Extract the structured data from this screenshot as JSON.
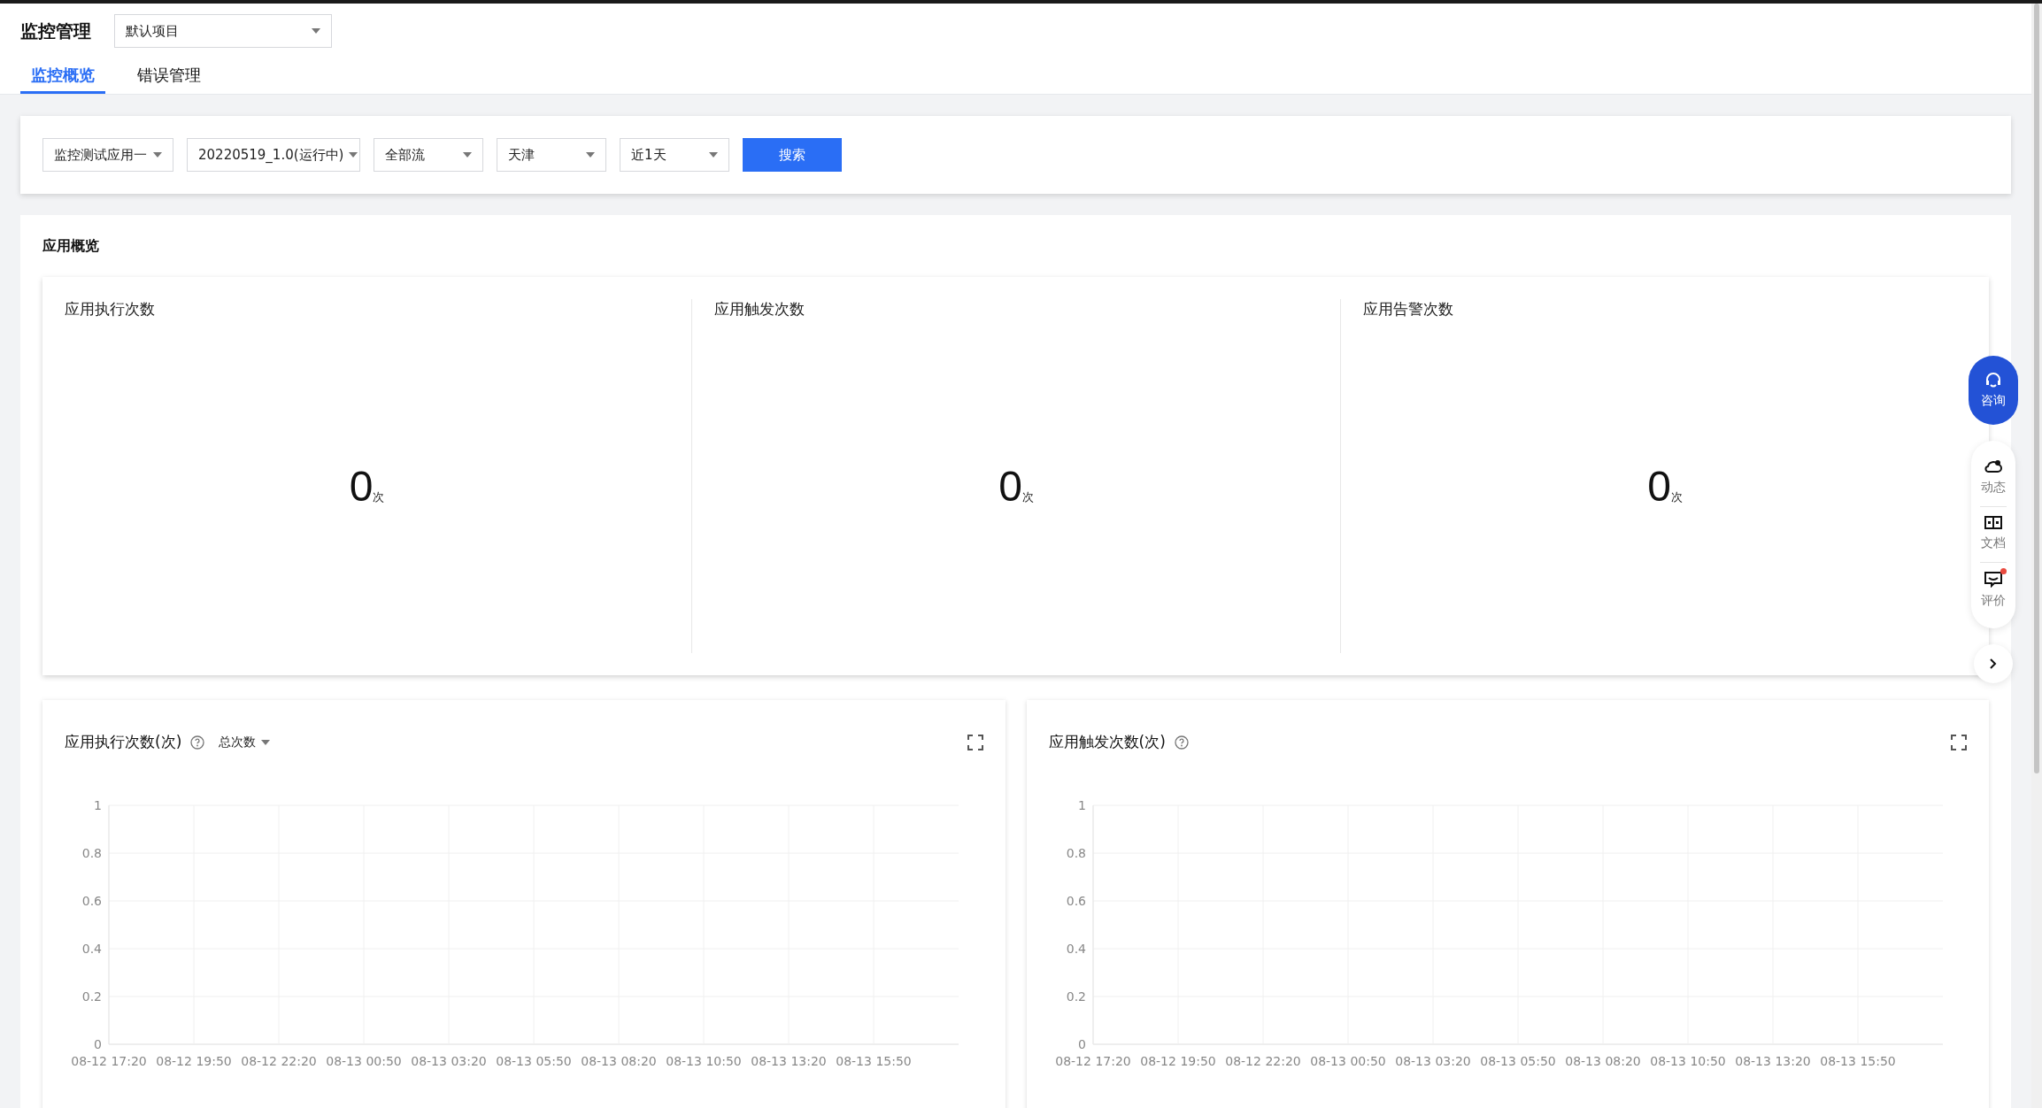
{
  "header": {
    "title": "监控管理",
    "project_select": "默认项目"
  },
  "tabs": [
    {
      "label": "监控概览",
      "selected": true
    },
    {
      "label": "错误管理",
      "selected": false
    }
  ],
  "filters": {
    "selects": [
      "监控测试应用一",
      "20220519_1.0(运行中)",
      "全部流",
      "天津",
      "近1天"
    ],
    "search_button": "搜索"
  },
  "overview": {
    "title": "应用概览",
    "stats": [
      {
        "label": "应用执行次数",
        "value": "0",
        "unit": "次"
      },
      {
        "label": "应用触发次数",
        "value": "0",
        "unit": "次"
      },
      {
        "label": "应用告警次数",
        "value": "0",
        "unit": "次"
      }
    ]
  },
  "charts": [
    {
      "title": "应用执行次数(次)",
      "dropdown": "总次数",
      "chart_data": {
        "type": "line",
        "grid": true,
        "categories": [
          "08-12 17:20",
          "08-12 19:50",
          "08-12 22:20",
          "08-13 00:50",
          "08-13 03:20",
          "08-13 05:50",
          "08-13 08:20",
          "08-13 10:50",
          "08-13 13:20",
          "08-13 15:50"
        ],
        "ylim": [
          0,
          1
        ],
        "yticks": [
          0,
          0.2,
          0.4,
          0.6,
          0.8,
          1
        ]
      }
    },
    {
      "title": "应用触发次数(次)",
      "chart_data": {
        "type": "line",
        "grid": true,
        "categories": [
          "08-12 17:20",
          "08-12 19:50",
          "08-12 22:20",
          "08-13 00:50",
          "08-13 03:20",
          "08-13 05:50",
          "08-13 08:20",
          "08-13 10:50",
          "08-13 13:20",
          "08-13 15:50"
        ],
        "ylim": [
          0,
          1
        ],
        "yticks": [
          0,
          0.2,
          0.4,
          0.6,
          0.8,
          1
        ]
      }
    }
  ],
  "side_tools": {
    "consult": "咨询",
    "items": [
      {
        "kind": "news",
        "label": "动态",
        "badge": false
      },
      {
        "kind": "docs",
        "label": "文档",
        "badge": false
      },
      {
        "kind": "feedback",
        "label": "评价",
        "badge": true
      }
    ]
  }
}
